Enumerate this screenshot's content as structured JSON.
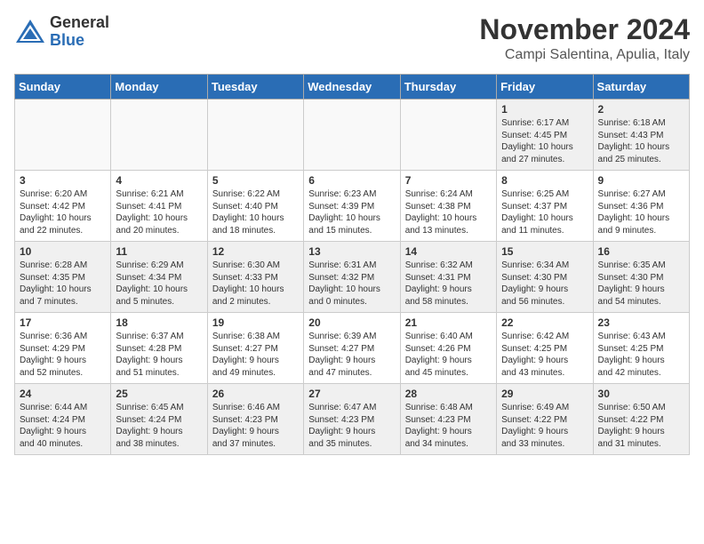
{
  "header": {
    "logo_general": "General",
    "logo_blue": "Blue",
    "month_year": "November 2024",
    "location": "Campi Salentina, Apulia, Italy"
  },
  "days_of_week": [
    "Sunday",
    "Monday",
    "Tuesday",
    "Wednesday",
    "Thursday",
    "Friday",
    "Saturday"
  ],
  "weeks": [
    [
      {
        "day": "",
        "empty": true
      },
      {
        "day": "",
        "empty": true
      },
      {
        "day": "",
        "empty": true
      },
      {
        "day": "",
        "empty": true
      },
      {
        "day": "",
        "empty": true
      },
      {
        "day": "1",
        "lines": [
          "Sunrise: 6:17 AM",
          "Sunset: 4:45 PM",
          "Daylight: 10 hours",
          "and 27 minutes."
        ]
      },
      {
        "day": "2",
        "lines": [
          "Sunrise: 6:18 AM",
          "Sunset: 4:43 PM",
          "Daylight: 10 hours",
          "and 25 minutes."
        ]
      }
    ],
    [
      {
        "day": "3",
        "lines": [
          "Sunrise: 6:20 AM",
          "Sunset: 4:42 PM",
          "Daylight: 10 hours",
          "and 22 minutes."
        ]
      },
      {
        "day": "4",
        "lines": [
          "Sunrise: 6:21 AM",
          "Sunset: 4:41 PM",
          "Daylight: 10 hours",
          "and 20 minutes."
        ]
      },
      {
        "day": "5",
        "lines": [
          "Sunrise: 6:22 AM",
          "Sunset: 4:40 PM",
          "Daylight: 10 hours",
          "and 18 minutes."
        ]
      },
      {
        "day": "6",
        "lines": [
          "Sunrise: 6:23 AM",
          "Sunset: 4:39 PM",
          "Daylight: 10 hours",
          "and 15 minutes."
        ]
      },
      {
        "day": "7",
        "lines": [
          "Sunrise: 6:24 AM",
          "Sunset: 4:38 PM",
          "Daylight: 10 hours",
          "and 13 minutes."
        ]
      },
      {
        "day": "8",
        "lines": [
          "Sunrise: 6:25 AM",
          "Sunset: 4:37 PM",
          "Daylight: 10 hours",
          "and 11 minutes."
        ]
      },
      {
        "day": "9",
        "lines": [
          "Sunrise: 6:27 AM",
          "Sunset: 4:36 PM",
          "Daylight: 10 hours",
          "and 9 minutes."
        ]
      }
    ],
    [
      {
        "day": "10",
        "lines": [
          "Sunrise: 6:28 AM",
          "Sunset: 4:35 PM",
          "Daylight: 10 hours",
          "and 7 minutes."
        ]
      },
      {
        "day": "11",
        "lines": [
          "Sunrise: 6:29 AM",
          "Sunset: 4:34 PM",
          "Daylight: 10 hours",
          "and 5 minutes."
        ]
      },
      {
        "day": "12",
        "lines": [
          "Sunrise: 6:30 AM",
          "Sunset: 4:33 PM",
          "Daylight: 10 hours",
          "and 2 minutes."
        ]
      },
      {
        "day": "13",
        "lines": [
          "Sunrise: 6:31 AM",
          "Sunset: 4:32 PM",
          "Daylight: 10 hours",
          "and 0 minutes."
        ]
      },
      {
        "day": "14",
        "lines": [
          "Sunrise: 6:32 AM",
          "Sunset: 4:31 PM",
          "Daylight: 9 hours",
          "and 58 minutes."
        ]
      },
      {
        "day": "15",
        "lines": [
          "Sunrise: 6:34 AM",
          "Sunset: 4:30 PM",
          "Daylight: 9 hours",
          "and 56 minutes."
        ]
      },
      {
        "day": "16",
        "lines": [
          "Sunrise: 6:35 AM",
          "Sunset: 4:30 PM",
          "Daylight: 9 hours",
          "and 54 minutes."
        ]
      }
    ],
    [
      {
        "day": "17",
        "lines": [
          "Sunrise: 6:36 AM",
          "Sunset: 4:29 PM",
          "Daylight: 9 hours",
          "and 52 minutes."
        ]
      },
      {
        "day": "18",
        "lines": [
          "Sunrise: 6:37 AM",
          "Sunset: 4:28 PM",
          "Daylight: 9 hours",
          "and 51 minutes."
        ]
      },
      {
        "day": "19",
        "lines": [
          "Sunrise: 6:38 AM",
          "Sunset: 4:27 PM",
          "Daylight: 9 hours",
          "and 49 minutes."
        ]
      },
      {
        "day": "20",
        "lines": [
          "Sunrise: 6:39 AM",
          "Sunset: 4:27 PM",
          "Daylight: 9 hours",
          "and 47 minutes."
        ]
      },
      {
        "day": "21",
        "lines": [
          "Sunrise: 6:40 AM",
          "Sunset: 4:26 PM",
          "Daylight: 9 hours",
          "and 45 minutes."
        ]
      },
      {
        "day": "22",
        "lines": [
          "Sunrise: 6:42 AM",
          "Sunset: 4:25 PM",
          "Daylight: 9 hours",
          "and 43 minutes."
        ]
      },
      {
        "day": "23",
        "lines": [
          "Sunrise: 6:43 AM",
          "Sunset: 4:25 PM",
          "Daylight: 9 hours",
          "and 42 minutes."
        ]
      }
    ],
    [
      {
        "day": "24",
        "lines": [
          "Sunrise: 6:44 AM",
          "Sunset: 4:24 PM",
          "Daylight: 9 hours",
          "and 40 minutes."
        ]
      },
      {
        "day": "25",
        "lines": [
          "Sunrise: 6:45 AM",
          "Sunset: 4:24 PM",
          "Daylight: 9 hours",
          "and 38 minutes."
        ]
      },
      {
        "day": "26",
        "lines": [
          "Sunrise: 6:46 AM",
          "Sunset: 4:23 PM",
          "Daylight: 9 hours",
          "and 37 minutes."
        ]
      },
      {
        "day": "27",
        "lines": [
          "Sunrise: 6:47 AM",
          "Sunset: 4:23 PM",
          "Daylight: 9 hours",
          "and 35 minutes."
        ]
      },
      {
        "day": "28",
        "lines": [
          "Sunrise: 6:48 AM",
          "Sunset: 4:23 PM",
          "Daylight: 9 hours",
          "and 34 minutes."
        ]
      },
      {
        "day": "29",
        "lines": [
          "Sunrise: 6:49 AM",
          "Sunset: 4:22 PM",
          "Daylight: 9 hours",
          "and 33 minutes."
        ]
      },
      {
        "day": "30",
        "lines": [
          "Sunrise: 6:50 AM",
          "Sunset: 4:22 PM",
          "Daylight: 9 hours",
          "and 31 minutes."
        ]
      }
    ]
  ]
}
